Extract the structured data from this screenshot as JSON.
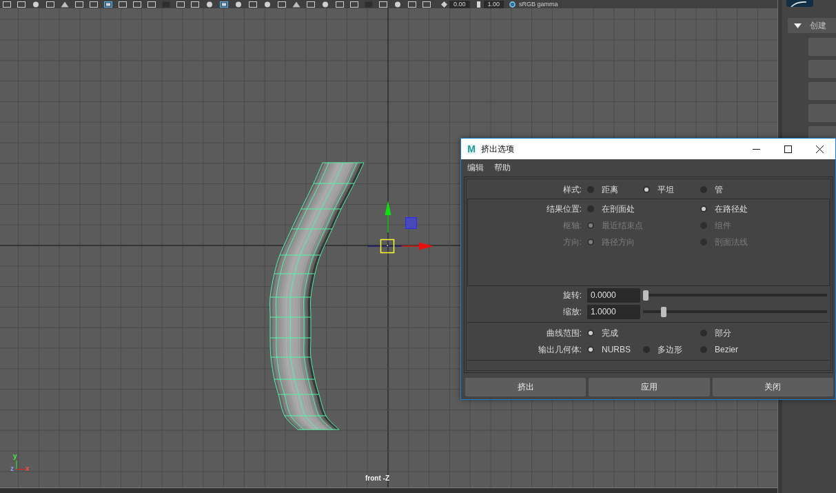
{
  "toolbar": {
    "fields": [
      {
        "value": "0.00"
      },
      {
        "value": "1.00"
      }
    ],
    "color_space": "sRGB gamma"
  },
  "viewport": {
    "axes": [
      {
        "label": "y"
      },
      {
        "label": "z"
      },
      {
        "label": "x"
      }
    ],
    "camera_label": "front -Z"
  },
  "side_panel": {
    "section": {
      "title": "创建",
      "expanded": true
    }
  },
  "dialog": {
    "icon": "M",
    "title": "挤出选项",
    "menu": [
      {
        "label": "编辑"
      },
      {
        "label": "帮助"
      }
    ],
    "sections": [
      {
        "kind": "plain",
        "rows": [
          {
            "kind": "radio",
            "label": "样式:",
            "disabled": false,
            "options": [
              {
                "label": "距离",
                "selected": false
              },
              {
                "label": "平坦",
                "selected": true
              },
              {
                "label": "管",
                "selected": false
              }
            ]
          }
        ]
      },
      {
        "kind": "group_box",
        "rows": [
          {
            "kind": "radio",
            "label": "结果位置:",
            "disabled": false,
            "options": [
              {
                "label": "在剖面处",
                "selected": false
              },
              {
                "label": "在路径处",
                "selected": true
              }
            ]
          },
          {
            "kind": "radio",
            "label": "枢轴:",
            "disabled": true,
            "options": [
              {
                "label": "最近结束点",
                "selected": true
              },
              {
                "label": "组件",
                "selected": false
              }
            ]
          },
          {
            "kind": "radio",
            "label": "方向:",
            "disabled": true,
            "options": [
              {
                "label": "路径方向",
                "selected": true
              },
              {
                "label": "剖面法线",
                "selected": false
              }
            ]
          }
        ]
      },
      {
        "kind": "plain",
        "rows": [
          {
            "kind": "slider",
            "label": "旋转:",
            "disabled": false,
            "value": "0.0000",
            "level": 0
          },
          {
            "kind": "slider",
            "label": "缩放:",
            "disabled": false,
            "value": "1.0000",
            "level": 0.1
          }
        ]
      },
      {
        "kind": "plain",
        "rows": [
          {
            "kind": "radio",
            "label": "曲线范围:",
            "disabled": false,
            "options": [
              {
                "label": "完成",
                "selected": true
              },
              {
                "label": "部分",
                "selected": false
              }
            ]
          },
          {
            "kind": "radio",
            "label": "输出几何体:",
            "disabled": false,
            "options": [
              {
                "label": "NURBS",
                "selected": true
              },
              {
                "label": "多边形",
                "selected": false
              },
              {
                "label": "Bezier",
                "selected": false
              }
            ]
          }
        ]
      }
    ],
    "buttons": [
      {
        "label": "挤出"
      },
      {
        "label": "应用"
      },
      {
        "label": "关闭"
      }
    ]
  }
}
